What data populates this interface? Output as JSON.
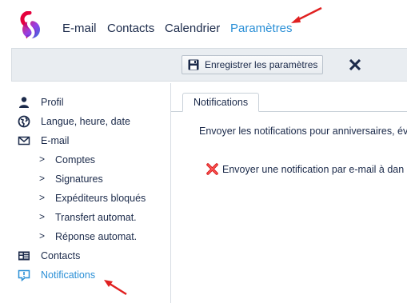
{
  "nav": {
    "items": [
      {
        "label": "E-mail"
      },
      {
        "label": "Contacts"
      },
      {
        "label": "Calendrier"
      },
      {
        "label": "Paramètres",
        "active": true
      }
    ]
  },
  "toolbar": {
    "save_label": "Enregistrer les paramètres",
    "save_icon": "floppy-disk-icon",
    "close_icon": "close-x-icon"
  },
  "sidebar": {
    "items": [
      {
        "label": "Profil",
        "icon": "person-icon"
      },
      {
        "label": "Langue, heure, date",
        "icon": "globe-icon"
      },
      {
        "label": "E-mail",
        "icon": "envelope-icon"
      },
      {
        "label": "Comptes",
        "icon": "chevron-right-icon"
      },
      {
        "label": "Signatures",
        "icon": "chevron-right-icon"
      },
      {
        "label": "Expéditeurs bloqués",
        "icon": "chevron-right-icon"
      },
      {
        "label": "Transfert automat.",
        "icon": "chevron-right-icon"
      },
      {
        "label": "Réponse automat.",
        "icon": "chevron-right-icon"
      },
      {
        "label": "Contacts",
        "icon": "address-card-icon"
      },
      {
        "label": "Notifications",
        "icon": "notification-icon",
        "active": true
      }
    ]
  },
  "main": {
    "tab_label": "Notifications",
    "description": "Envoyer les notifications pour anniversaires, év",
    "option": {
      "label": "Envoyer une notification par e-mail à dan",
      "checked": false,
      "icon": "red-x-checkbox-icon"
    }
  },
  "colors": {
    "accent": "#2a8fd6",
    "text": "#1b2a4a",
    "toolbar_bg": "#e9edf1",
    "annotation_arrow": "#e02020"
  }
}
